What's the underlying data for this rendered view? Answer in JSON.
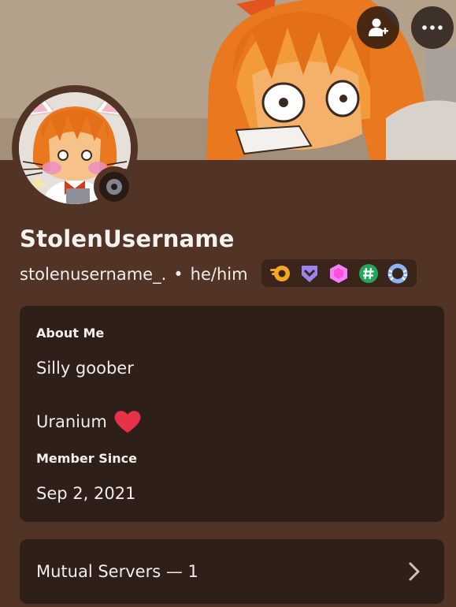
{
  "profile": {
    "display_name": "StolenUsername",
    "username": "stolenusername_.",
    "separator": "•",
    "pronouns": "he/him",
    "status": "offline"
  },
  "badges": [
    {
      "icon": "orange-boost-badge-icon"
    },
    {
      "icon": "purple-shield-badge-icon"
    },
    {
      "icon": "pink-nitro-gem-badge-icon"
    },
    {
      "icon": "green-hashtag-badge-icon"
    },
    {
      "icon": "blue-laurel-badge-icon"
    }
  ],
  "about": {
    "label": "About Me",
    "line1": "Silly goober",
    "line2": "Uranium",
    "emoji": "heart-icon"
  },
  "member_since": {
    "label": "Member Since",
    "date": "Sep 2, 2021"
  },
  "mutual": {
    "label": "Mutual Servers — 1"
  },
  "colors": {
    "background": "#523427",
    "card": "#2f1f19",
    "status_offline": "#80848e",
    "heart": "#e8324a"
  }
}
